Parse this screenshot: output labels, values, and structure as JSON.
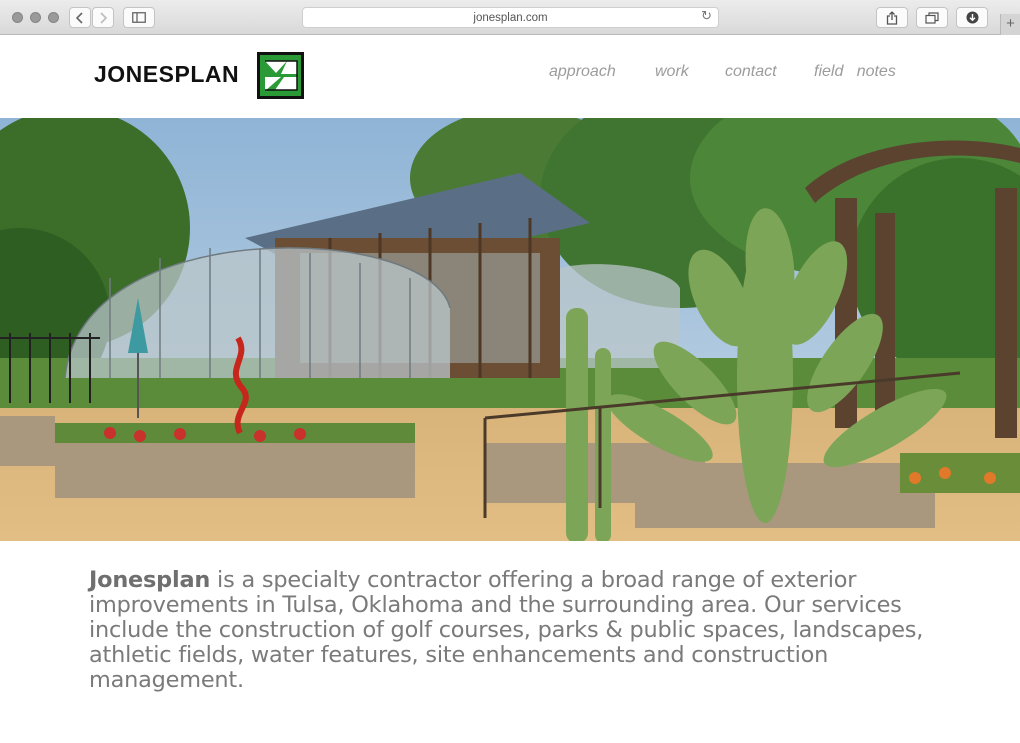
{
  "browser": {
    "url": "jonesplan.com",
    "back_icon": "chevron-left-icon",
    "forward_icon": "chevron-right-icon",
    "sidebar_icon": "sidebar-icon",
    "reload_icon": "reload-icon",
    "share_icon": "share-icon",
    "tabs_icon": "tabs-icon",
    "download_icon": "download-icon",
    "new_tab_label": "+"
  },
  "site": {
    "logo_text": "JONESPLAN",
    "brand_color": "#2a9a36",
    "nav": [
      {
        "label": "approach"
      },
      {
        "label": "work"
      },
      {
        "label": "contact"
      },
      {
        "label": "field   notes"
      }
    ]
  },
  "intro": {
    "brand": "Jonesplan",
    "text": " is a specialty contractor offering a broad range of exterior improvements in Tulsa, Oklahoma and the surrounding area. Our services include the construction of golf courses, parks & public spaces, landscapes, athletic fields, water features, site enhancements and construction management."
  }
}
